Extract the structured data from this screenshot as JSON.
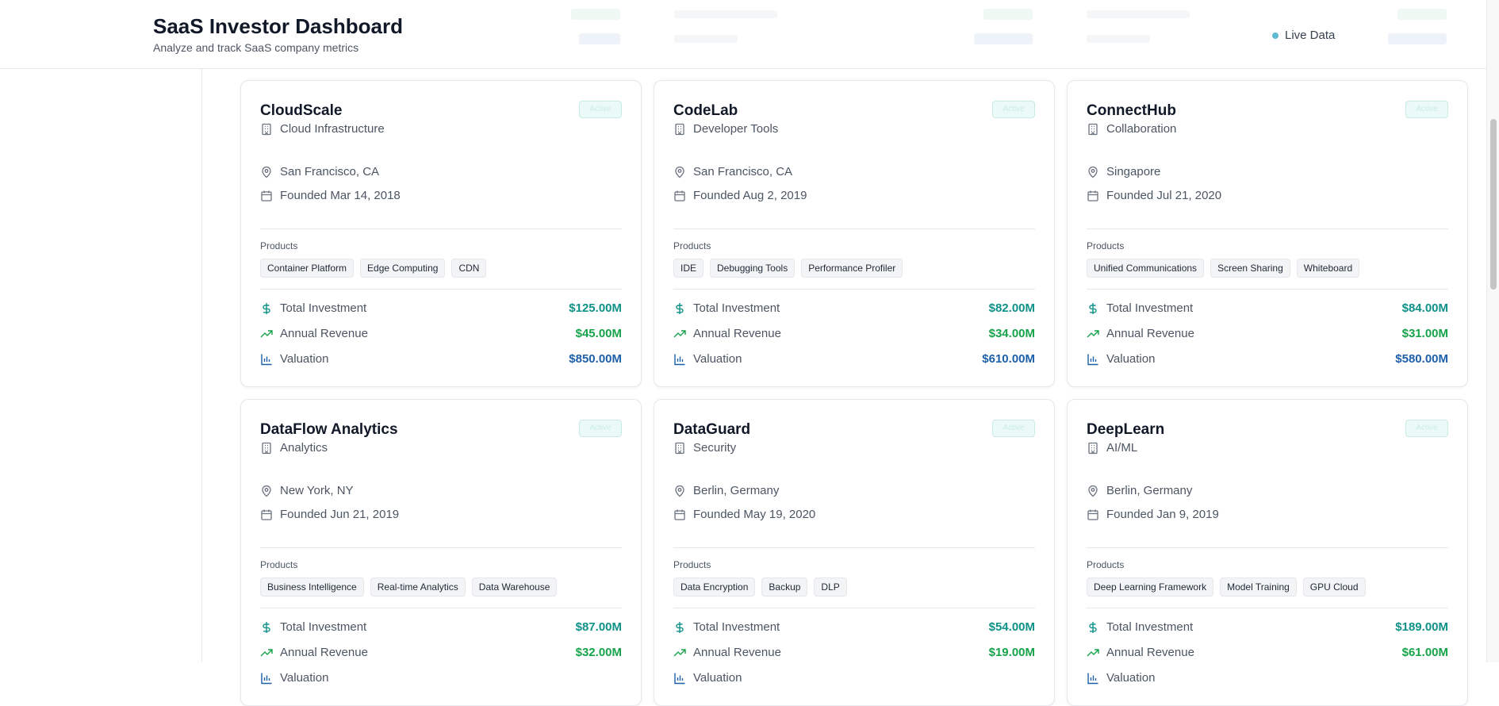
{
  "header": {
    "title": "SaaS Investor Dashboard",
    "subtitle": "Analyze and track SaaS company metrics",
    "live_label": "Live Data"
  },
  "colors": {
    "investment": "#0e9188",
    "revenue": "#16a34a",
    "valuation": "#1d5fa8",
    "icon": "#6b7280",
    "live_dot": "#5eb9d0"
  },
  "labels": {
    "products": "Products",
    "total_investment": "Total Investment",
    "annual_revenue": "Annual Revenue",
    "valuation": "Valuation"
  },
  "companies": [
    {
      "name": "CloudScale",
      "status": "Active",
      "category": "Cloud Infrastructure",
      "location": "San Francisco, CA",
      "founded": "Founded Mar 14, 2018",
      "products": [
        "Container Platform",
        "Edge Computing",
        "CDN"
      ],
      "investment": "$125.00M",
      "revenue": "$45.00M",
      "valuation": "$850.00M"
    },
    {
      "name": "CodeLab",
      "status": "Active",
      "category": "Developer Tools",
      "location": "San Francisco, CA",
      "founded": "Founded Aug 2, 2019",
      "products": [
        "IDE",
        "Debugging Tools",
        "Performance Profiler"
      ],
      "investment": "$82.00M",
      "revenue": "$34.00M",
      "valuation": "$610.00M"
    },
    {
      "name": "ConnectHub",
      "status": "Active",
      "category": "Collaboration",
      "location": "Singapore",
      "founded": "Founded Jul 21, 2020",
      "products": [
        "Unified Communications",
        "Screen Sharing",
        "Whiteboard"
      ],
      "investment": "$84.00M",
      "revenue": "$31.00M",
      "valuation": "$580.00M"
    },
    {
      "name": "DataFlow Analytics",
      "status": "Active",
      "category": "Analytics",
      "location": "New York, NY",
      "founded": "Founded Jun 21, 2019",
      "products": [
        "Business Intelligence",
        "Real-time Analytics",
        "Data Warehouse"
      ],
      "investment": "$87.00M",
      "revenue": "$32.00M",
      "valuation": ""
    },
    {
      "name": "DataGuard",
      "status": "Active",
      "category": "Security",
      "location": "Berlin, Germany",
      "founded": "Founded May 19, 2020",
      "products": [
        "Data Encryption",
        "Backup",
        "DLP"
      ],
      "investment": "$54.00M",
      "revenue": "$19.00M",
      "valuation": ""
    },
    {
      "name": "DeepLearn",
      "status": "Active",
      "category": "AI/ML",
      "location": "Berlin, Germany",
      "founded": "Founded Jan 9, 2019",
      "products": [
        "Deep Learning Framework",
        "Model Training",
        "GPU Cloud"
      ],
      "investment": "$189.00M",
      "revenue": "$61.00M",
      "valuation": ""
    }
  ]
}
